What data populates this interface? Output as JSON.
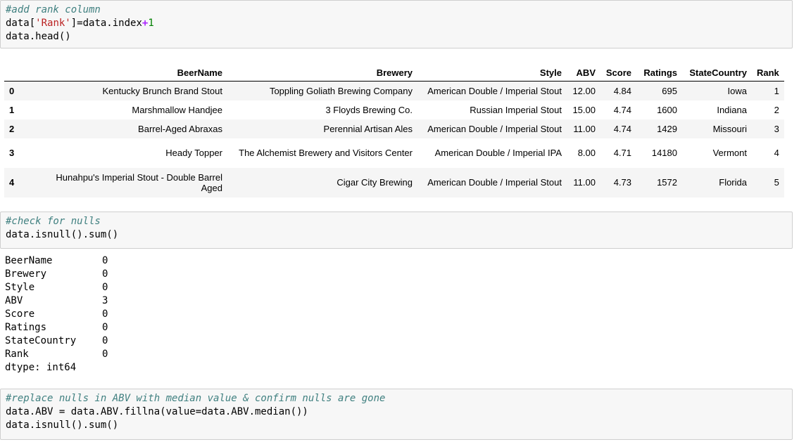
{
  "cell1": {
    "comment": "#add rank column",
    "line2": {
      "a": "data[",
      "str": "'Rank'",
      "b": "]=data.index",
      "op": "+",
      "num": "1"
    },
    "line3": "data.head()"
  },
  "dataframe": {
    "headers": [
      "",
      "BeerName",
      "Brewery",
      "Style",
      "ABV",
      "Score",
      "Ratings",
      "StateCountry",
      "Rank"
    ],
    "rows": [
      {
        "idx": "0",
        "BeerName": "Kentucky Brunch Brand Stout",
        "Brewery": "Toppling Goliath Brewing Company",
        "Style": "American Double / Imperial Stout",
        "ABV": "12.00",
        "Score": "4.84",
        "Ratings": "695",
        "StateCountry": "Iowa",
        "Rank": "1"
      },
      {
        "idx": "1",
        "BeerName": "Marshmallow Handjee",
        "Brewery": "3 Floyds Brewing Co.",
        "Style": "Russian Imperial Stout",
        "ABV": "15.00",
        "Score": "4.74",
        "Ratings": "1600",
        "StateCountry": "Indiana",
        "Rank": "2"
      },
      {
        "idx": "2",
        "BeerName": "Barrel-Aged Abraxas",
        "Brewery": "Perennial Artisan Ales",
        "Style": "American Double / Imperial Stout",
        "ABV": "11.00",
        "Score": "4.74",
        "Ratings": "1429",
        "StateCountry": "Missouri",
        "Rank": "3"
      },
      {
        "idx": "3",
        "BeerName": "Heady Topper",
        "Brewery": "The Alchemist Brewery and Visitors Center",
        "Style": "American Double / Imperial IPA",
        "ABV": "8.00",
        "Score": "4.71",
        "Ratings": "14180",
        "StateCountry": "Vermont",
        "Rank": "4"
      },
      {
        "idx": "4",
        "BeerName": "Hunahpu's Imperial Stout - Double Barrel Aged",
        "Brewery": "Cigar City Brewing",
        "Style": "American Double / Imperial Stout",
        "ABV": "11.00",
        "Score": "4.73",
        "Ratings": "1572",
        "StateCountry": "Florida",
        "Rank": "5"
      }
    ]
  },
  "cell2": {
    "comment": "#check for nulls",
    "line2": "data.isnull().sum()"
  },
  "output2": {
    "rows": [
      {
        "k": "BeerName",
        "v": "0"
      },
      {
        "k": "Brewery",
        "v": "0"
      },
      {
        "k": "Style",
        "v": "0"
      },
      {
        "k": "ABV",
        "v": "3"
      },
      {
        "k": "Score",
        "v": "0"
      },
      {
        "k": "Ratings",
        "v": "0"
      },
      {
        "k": "StateCountry",
        "v": "0"
      },
      {
        "k": "Rank",
        "v": "0"
      }
    ],
    "dtype": "dtype: int64"
  },
  "cell3": {
    "comment": "#replace nulls in ABV with median value & confirm nulls are gone",
    "line2": "data.ABV = data.ABV.fillna(value=data.ABV.median())",
    "line3": "data.isnull().sum()"
  }
}
